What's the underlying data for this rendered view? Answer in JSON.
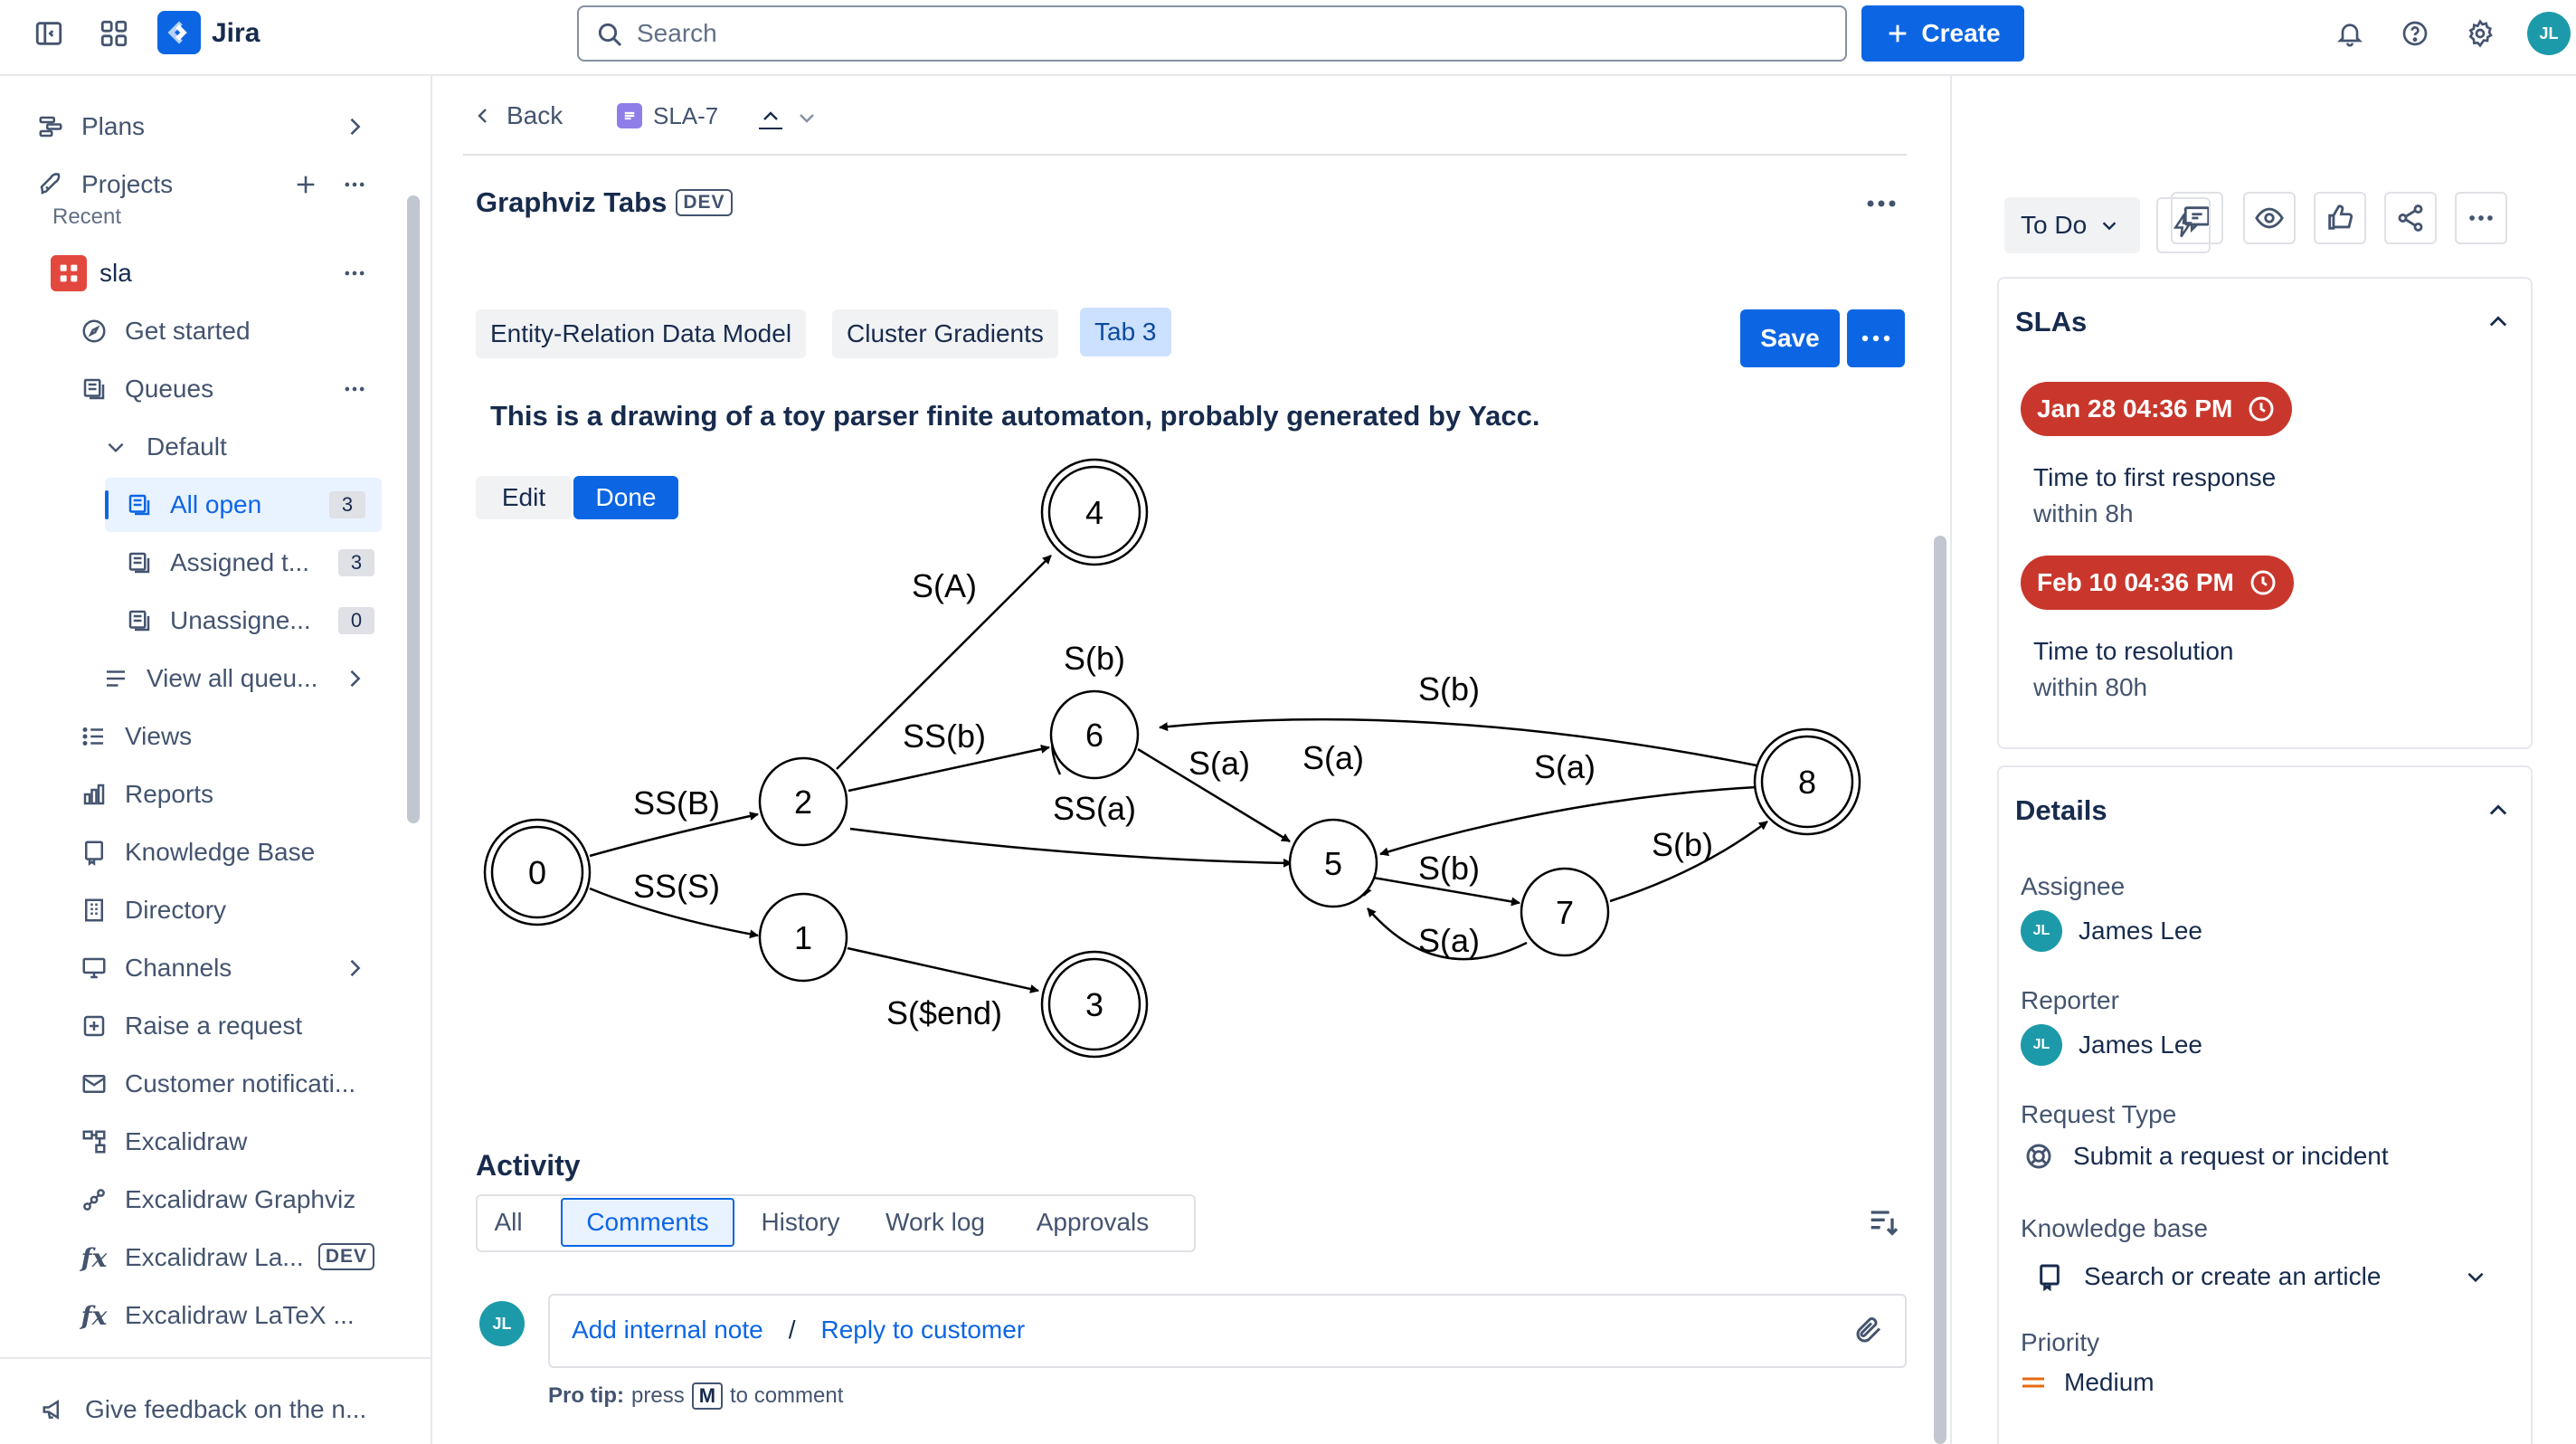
{
  "app": {
    "name": "Jira"
  },
  "colors": {
    "brand": "#0c66e4",
    "sla_badge": "#c9372c",
    "avatar": "#1d9aaa",
    "priority_medium": "#e56910"
  },
  "topbar": {
    "search_placeholder": "Search",
    "create_label": "Create",
    "avatar_initials": "JL"
  },
  "sidebar": {
    "plans": "Plans",
    "projects": "Projects",
    "recent": "Recent",
    "project_name": "sla",
    "items": {
      "get_started": "Get started",
      "queues": "Queues",
      "default": "Default",
      "all_open": "All open",
      "all_open_count": "3",
      "assigned": "Assigned t...",
      "assigned_count": "3",
      "unassigned": "Unassigne...",
      "unassigned_count": "0",
      "view_all": "View all queu...",
      "views": "Views",
      "reports": "Reports",
      "knowledge_base": "Knowledge Base",
      "directory": "Directory",
      "channels": "Channels",
      "raise_request": "Raise a request",
      "customer_notifications": "Customer notificati...",
      "excalidraw": "Excalidraw",
      "excalidraw_graphviz": "Excalidraw Graphviz",
      "excalidraw_la": "Excalidraw La...",
      "excalidraw_la_badge": "DEV",
      "excalidraw_latex": "Excalidraw LaTeX ..."
    },
    "feedback": "Give feedback on the n..."
  },
  "main": {
    "back_label": "Back",
    "issue_key": "SLA-7",
    "panel_title": "Graphviz Tabs",
    "panel_badge": "DEV",
    "tabs": [
      {
        "label": "Entity-Relation Data Model"
      },
      {
        "label": "Cluster Gradients"
      },
      {
        "label": "Tab 3"
      }
    ],
    "save_label": "Save",
    "description": "This is a drawing of a toy parser finite automaton, probably generated by Yacc.",
    "edit_label": "Edit",
    "done_label": "Done",
    "graph": {
      "nodes": {
        "n0": "0",
        "n1": "1",
        "n2": "2",
        "n3": "3",
        "n4": "4",
        "n5": "5",
        "n6": "6",
        "n7": "7",
        "n8": "8"
      },
      "edges": {
        "e02": "SS(B)",
        "e01": "SS(S)",
        "e24": "S(A)",
        "e26": "SS(b)",
        "e25": "SS(a)",
        "e13": "S($end)",
        "e66": "S(b)",
        "e65": "S(a)",
        "e55": "S(a)",
        "e86": "S(b)",
        "e85": "S(a)",
        "e57": "S(b)",
        "e75": "S(a)",
        "e78": "S(b)"
      }
    },
    "activity": {
      "title": "Activity",
      "tabs": [
        {
          "label": "All"
        },
        {
          "label": "Comments"
        },
        {
          "label": "History"
        },
        {
          "label": "Work log"
        },
        {
          "label": "Approvals"
        }
      ],
      "add_note": "Add internal note",
      "separator": "/",
      "reply": "Reply to customer",
      "pro_tip_label": "Pro tip:",
      "pro_tip_press": "press",
      "pro_tip_key": "M",
      "pro_tip_rest": "to comment"
    }
  },
  "right": {
    "status": "To Do",
    "slas": {
      "title": "SLAs",
      "items": [
        {
          "date": "Jan 28 04:36 PM",
          "label": "Time to first response",
          "within": "within 8h"
        },
        {
          "date": "Feb 10 04:36 PM",
          "label": "Time to resolution",
          "within": "within 80h"
        }
      ]
    },
    "details": {
      "title": "Details",
      "assignee_label": "Assignee",
      "assignee": "James Lee",
      "reporter_label": "Reporter",
      "reporter": "James Lee",
      "request_type_label": "Request Type",
      "request_type": "Submit a request or incident",
      "kb_label": "Knowledge base",
      "kb_value": "Search or create an article",
      "priority_label": "Priority",
      "priority": "Medium"
    }
  }
}
